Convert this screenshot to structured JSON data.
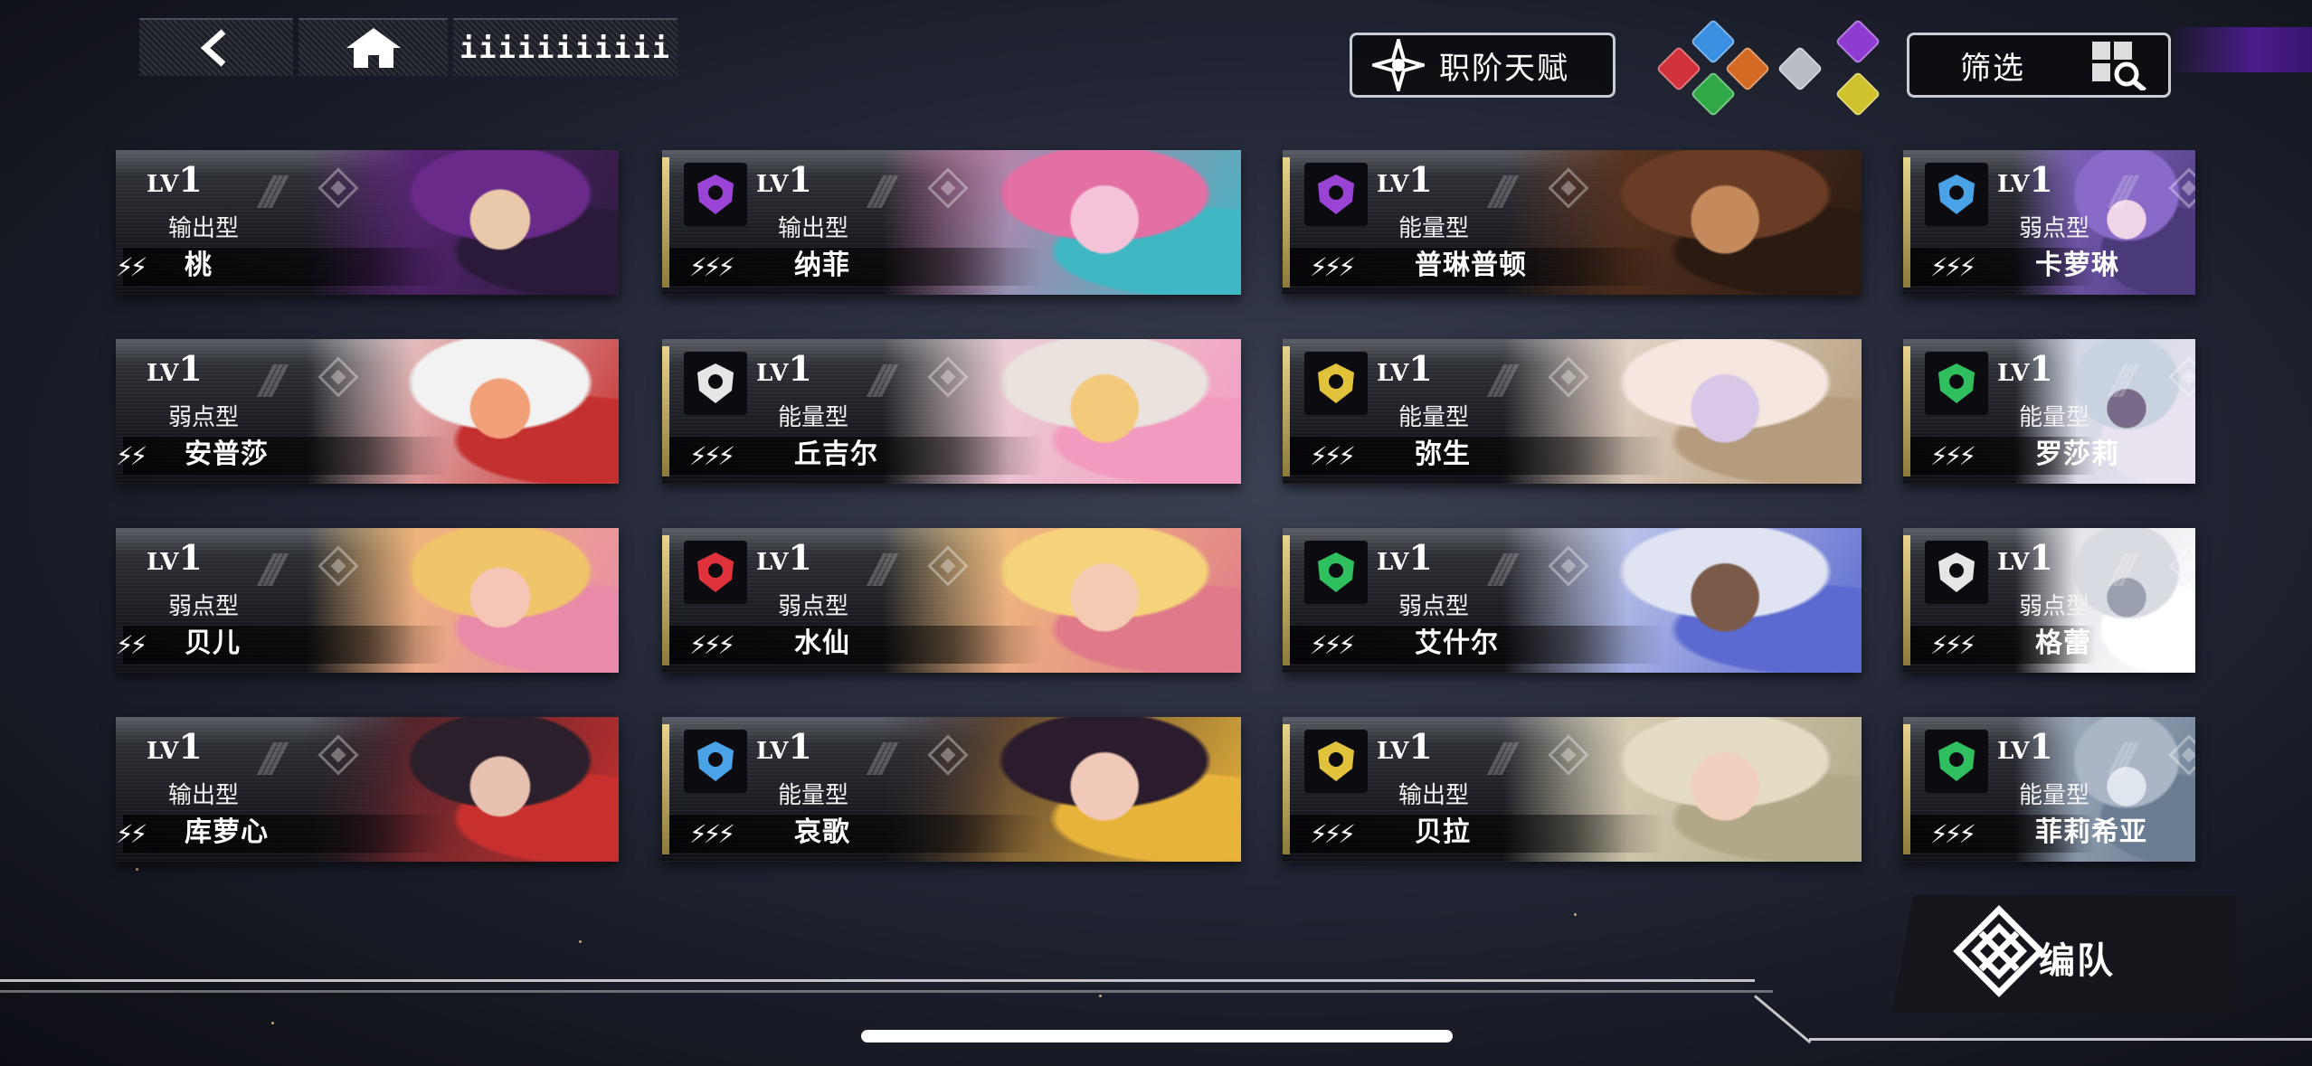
{
  "topbar": {
    "back_icon": "chevron-left-icon",
    "home_icon": "home-icon",
    "tab_label": "iiiiiiiiiii"
  },
  "class_talent_button": {
    "label": "职阶天赋",
    "icon": "compass-star-icon"
  },
  "filter_button": {
    "label": "筛选",
    "icon": "grid-search-icon"
  },
  "element_gems": [
    {
      "name": "blue-element",
      "color": "#3a8fe0"
    },
    {
      "name": "red-element",
      "color": "#d0313a"
    },
    {
      "name": "orange-element",
      "color": "#d46a24"
    },
    {
      "name": "green-element",
      "color": "#2fa845"
    },
    {
      "name": "gray-element",
      "color": "#b9bcc4"
    },
    {
      "name": "purple-element",
      "color": "#8e3bd1"
    },
    {
      "name": "yellow-element",
      "color": "#cfc22c"
    }
  ],
  "class_colors": {
    "purple": "#9a44d6",
    "blue": "#4aa3e6",
    "green": "#2fbf5e",
    "gold": "#e0c33b",
    "red": "#e0323c",
    "white": "#e6e6e6",
    "orange": "#e07a2c"
  },
  "characters": [
    {
      "name": "桃",
      "level_prefix": "LV",
      "level": "1",
      "type": "输出型",
      "class_color": "orange",
      "art": [
        "#6a2a8a",
        "#e9c9a9",
        "#2a1a3a"
      ]
    },
    {
      "name": "纳菲",
      "level_prefix": "LV",
      "level": "1",
      "type": "输出型",
      "class_color": "purple",
      "art": [
        "#e36fa3",
        "#f5c3d7",
        "#3fb8c4"
      ]
    },
    {
      "name": "普琳普顿",
      "level_prefix": "LV",
      "level": "1",
      "type": "能量型",
      "class_color": "purple",
      "art": [
        "#6a3c25",
        "#c58a5c",
        "#2a1a12"
      ]
    },
    {
      "name": "卡萝琳",
      "level_prefix": "LV",
      "level": "1",
      "type": "弱点型",
      "class_color": "blue",
      "art": [
        "#8a6ac8",
        "#f0d5e6",
        "#4a3a7a"
      ]
    },
    {
      "name": "安普莎",
      "level_prefix": "LV",
      "level": "1",
      "type": "弱点型",
      "class_color": "red",
      "art": [
        "#f2f2f2",
        "#f2a07a",
        "#c43030"
      ]
    },
    {
      "name": "丘吉尔",
      "level_prefix": "LV",
      "level": "1",
      "type": "能量型",
      "class_color": "white",
      "art": [
        "#e9e2dd",
        "#f3c97b",
        "#f29abf"
      ]
    },
    {
      "name": "弥生",
      "level_prefix": "LV",
      "level": "1",
      "type": "能量型",
      "class_color": "gold",
      "art": [
        "#f5e6e0",
        "#d8c7e6",
        "#b49c7c"
      ]
    },
    {
      "name": "罗莎莉",
      "level_prefix": "LV",
      "level": "1",
      "type": "能量型",
      "class_color": "green",
      "art": [
        "#c9d2e0",
        "#7a6a8a",
        "#eae4f0"
      ]
    },
    {
      "name": "贝儿",
      "level_prefix": "LV",
      "level": "1",
      "type": "弱点型",
      "class_color": "red",
      "art": [
        "#f0c46a",
        "#f5c6b6",
        "#e88aa8"
      ]
    },
    {
      "name": "水仙",
      "level_prefix": "LV",
      "level": "1",
      "type": "弱点型",
      "class_color": "red",
      "art": [
        "#f5d37a",
        "#f3cbb3",
        "#e07a8a"
      ]
    },
    {
      "name": "艾什尔",
      "level_prefix": "LV",
      "level": "1",
      "type": "弱点型",
      "class_color": "green",
      "art": [
        "#e0e4f2",
        "#7b5a4a",
        "#5a6ad0"
      ]
    },
    {
      "name": "格蕾",
      "level_prefix": "LV",
      "level": "1",
      "type": "弱点型",
      "class_color": "white",
      "art": [
        "#d9dbe2",
        "#9aa0ad",
        "#ffffff"
      ]
    },
    {
      "name": "库萝心",
      "level_prefix": "LV",
      "level": "1",
      "type": "输出型",
      "class_color": "orange",
      "art": [
        "#2a1f2a",
        "#e8c2b0",
        "#c8302e"
      ]
    },
    {
      "name": "哀歌",
      "level_prefix": "LV",
      "level": "1",
      "type": "能量型",
      "class_color": "blue",
      "art": [
        "#2a1c2c",
        "#f0c9b8",
        "#e8b33a"
      ]
    },
    {
      "name": "贝拉",
      "level_prefix": "LV",
      "level": "1",
      "type": "输出型",
      "class_color": "gold",
      "art": [
        "#e5dcc5",
        "#f2d0c0",
        "#b0a888"
      ]
    },
    {
      "name": "菲莉希亚",
      "level_prefix": "LV",
      "level": "1",
      "type": "能量型",
      "class_color": "green",
      "art": [
        "#aab6c6",
        "#e0e6ee",
        "#6a7c92"
      ]
    }
  ],
  "formation_button": {
    "label": "编队",
    "icon": "knot-emblem-icon"
  }
}
